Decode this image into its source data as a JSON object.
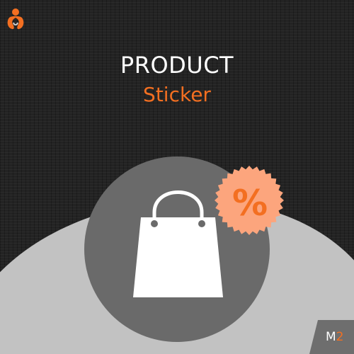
{
  "header": {
    "title": "PRODUCT",
    "subtitle": "Sticker"
  },
  "sticker": {
    "symbol": "%"
  },
  "version_badge": {
    "letter": "M",
    "number": "2"
  },
  "icons": {
    "brand_logo": "brand-logo-icon",
    "shopping_bag": "shopping-bag-icon",
    "discount_sticker": "discount-sticker-icon"
  },
  "colors": {
    "accent": "#f36f21",
    "background": "#232323",
    "hill": "#c2c2c2",
    "circle": "#6a6a6a",
    "sticker": "#fca57d",
    "bag": "#ffffff"
  }
}
